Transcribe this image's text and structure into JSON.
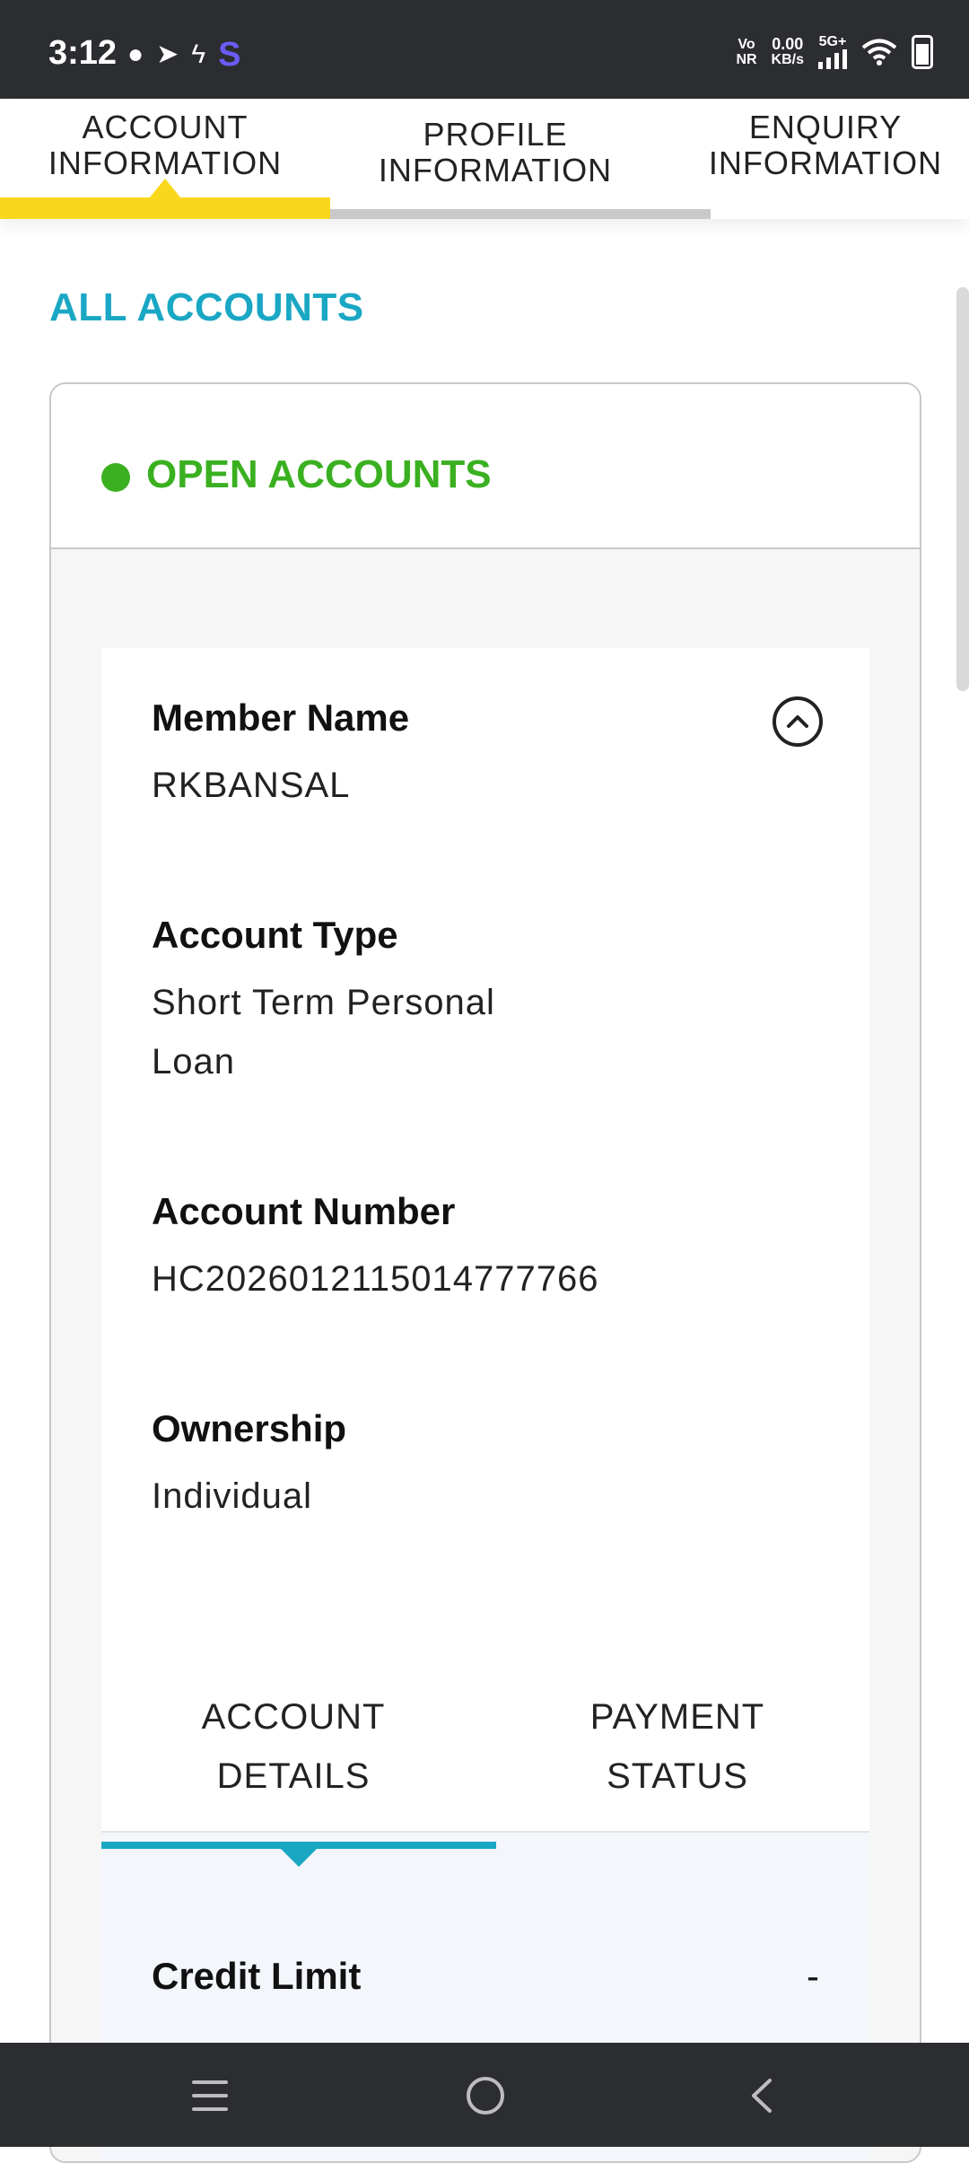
{
  "status_bar": {
    "time": "3:12",
    "network_vo": "Vo",
    "network_nr": "NR",
    "speed_value": "0.00",
    "speed_unit": "KB/s",
    "signal_type": "5G+"
  },
  "top_tabs": [
    {
      "line1": "ACCOUNT",
      "line2": "INFORMATION",
      "active": true
    },
    {
      "line1": "PROFILE",
      "line2": "INFORMATION",
      "active": false
    },
    {
      "line1": "ENQUIRY",
      "line2": "INFORMATION",
      "active": false
    }
  ],
  "section_title": "ALL ACCOUNTS",
  "card": {
    "header": "OPEN ACCOUNTS",
    "fields": {
      "member_name_label": "Member Name",
      "member_name_value": "RKBANSAL",
      "account_type_label": "Account Type",
      "account_type_value_line1": "Short Term Personal",
      "account_type_value_line2": "Loan",
      "account_number_label": "Account Number",
      "account_number_value": "HC2026012115014777766",
      "ownership_label": "Ownership",
      "ownership_value": "Individual"
    },
    "sub_tabs": [
      {
        "line1": "ACCOUNT",
        "line2": "DETAILS",
        "active": true
      },
      {
        "line1": "PAYMENT",
        "line2": "STATUS",
        "active": false
      }
    ],
    "credit_limit_label": "Credit Limit",
    "credit_limit_value": "-"
  },
  "colors": {
    "accent_yellow": "#f9d71c",
    "accent_teal": "#1aa7c4",
    "open_green": "#3ab020"
  }
}
